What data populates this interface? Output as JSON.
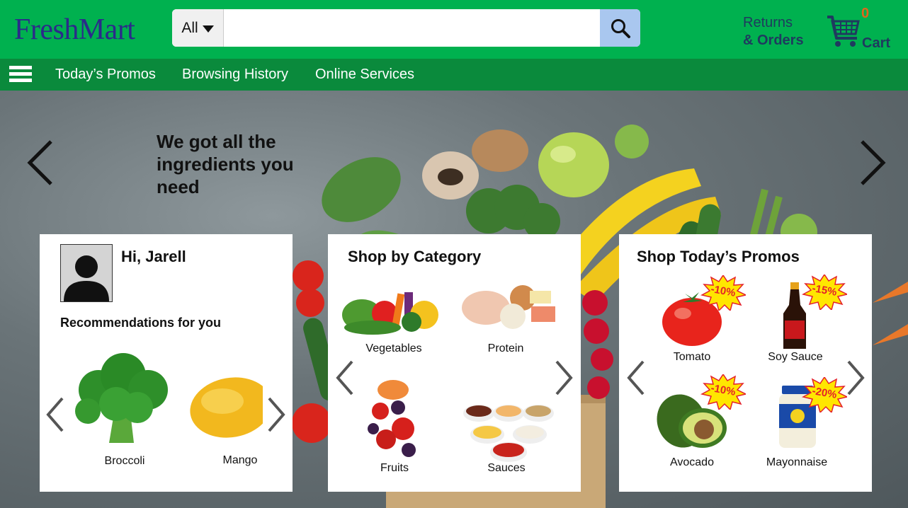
{
  "header": {
    "logo": "FreshMart",
    "search_category": "All",
    "search_placeholder": "",
    "returns_line1": "Returns",
    "returns_line2": "& Orders",
    "cart_count": "0",
    "cart_label": "Cart"
  },
  "nav": {
    "items": [
      {
        "label": "Today’s Promos"
      },
      {
        "label": "Browsing History"
      },
      {
        "label": "Online Services"
      }
    ]
  },
  "hero": {
    "headline": "We got all the ingredients you need"
  },
  "user_card": {
    "greeting": "Hi, Jarell",
    "recommendations_title": "Recommendations for you",
    "items": [
      {
        "label": "Broccoli",
        "icon": "broccoli-image"
      },
      {
        "label": "Mango",
        "icon": "mango-image"
      }
    ]
  },
  "category_card": {
    "title": "Shop by Category",
    "items": [
      {
        "label": "Vegetables",
        "icon": "vegetables-image"
      },
      {
        "label": "Protein",
        "icon": "protein-image"
      },
      {
        "label": "Fruits",
        "icon": "fruits-image"
      },
      {
        "label": "Sauces",
        "icon": "sauces-image"
      }
    ]
  },
  "promo_card": {
    "title": "Shop Today’s Promos",
    "items": [
      {
        "label": "Tomato",
        "discount": "-10%",
        "icon": "tomato-image"
      },
      {
        "label": "Soy Sauce",
        "discount": "-15%",
        "icon": "soy-sauce-image"
      },
      {
        "label": "Avocado",
        "discount": "-10%",
        "icon": "avocado-image"
      },
      {
        "label": "Mayonnaise",
        "discount": "-20%",
        "icon": "mayonnaise-image"
      }
    ]
  },
  "colors": {
    "header_green": "#00b14f",
    "nav_green": "#0a8a3c",
    "logo_blue": "#2b2a8a",
    "search_button": "#a9c7ef",
    "cart_count": "#e0661c",
    "badge_yellow": "#ffe600",
    "badge_red": "#e3202a"
  }
}
